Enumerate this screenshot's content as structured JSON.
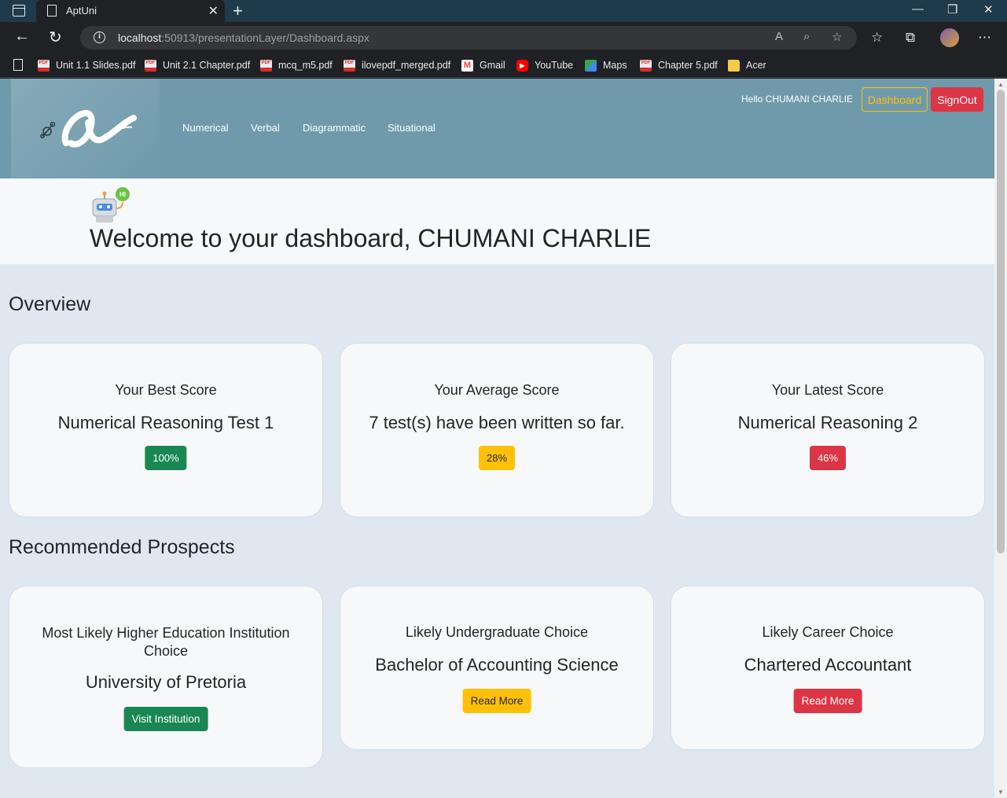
{
  "browser": {
    "tab_title": "AptUni",
    "url_host": "localhost",
    "url_rest": ":50913/presentationLayer/Dashboard.aspx",
    "bookmarks": [
      {
        "label": "Unit 1.1 Slides.pdf",
        "icon": "pdf-icon"
      },
      {
        "label": "Unit 2.1 Chapter.pdf",
        "icon": "pdf-icon"
      },
      {
        "label": "mcq_m5.pdf",
        "icon": "pdf-icon"
      },
      {
        "label": "ilovepdf_merged.pdf",
        "icon": "pdf-icon"
      },
      {
        "label": "Gmail",
        "icon": "gmail-icon"
      },
      {
        "label": "YouTube",
        "icon": "youtube-icon"
      },
      {
        "label": "Maps",
        "icon": "maps-icon"
      },
      {
        "label": "Chapter 5.pdf",
        "icon": "pdf-icon"
      },
      {
        "label": "Acer",
        "icon": "folder-icon"
      }
    ]
  },
  "header": {
    "nav": [
      "Numerical",
      "Verbal",
      "Diagrammatic",
      "Situational"
    ],
    "greeting": "Hello CHUMANI CHARLIE",
    "dashboard_label": "Dashboard",
    "signout_label": "SignOut"
  },
  "welcome": {
    "robot_bubble": "HI",
    "text": "Welcome to your dashboard, CHUMANI CHARLIE"
  },
  "overview": {
    "title": "Overview",
    "cards": [
      {
        "label": "Your Best Score",
        "value": "Numerical Reasoning Test 1",
        "badge": "100%",
        "badge_color": "#198754",
        "badge_text_color": "#ffffff"
      },
      {
        "label": "Your Average Score",
        "value": "7 test(s) have been written so far.",
        "badge": "28%",
        "badge_color": "#ffc107",
        "badge_text_color": "#212529"
      },
      {
        "label": "Your Latest Score",
        "value": "Numerical Reasoning 2",
        "badge": "46%",
        "badge_color": "#dc3545",
        "badge_text_color": "#ffffff"
      }
    ]
  },
  "prospects": {
    "title": "Recommended Prospects",
    "cards": [
      {
        "label": "Most Likely Higher Education Institution Choice",
        "value": "University of Pretoria",
        "button": "Visit Institution",
        "button_color": "#198754",
        "button_text_color": "#ffffff"
      },
      {
        "label": "Likely Undergraduate Choice",
        "value": "Bachelor of Accounting Science",
        "button": "Read More",
        "button_color": "#ffc107",
        "button_text_color": "#212529"
      },
      {
        "label": "Likely Career Choice",
        "value": "Chartered Accountant",
        "button": "Read More",
        "button_color": "#dc3545",
        "button_text_color": "#ffffff"
      }
    ]
  }
}
